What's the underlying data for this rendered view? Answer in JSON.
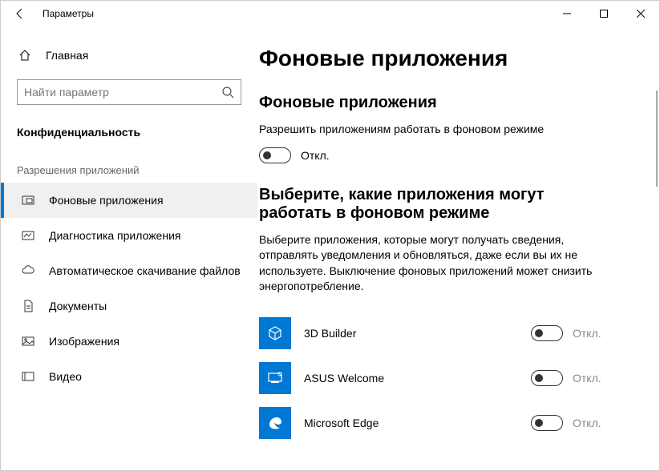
{
  "window": {
    "title": "Параметры"
  },
  "sidebar": {
    "home": "Главная",
    "search_placeholder": "Найти параметр",
    "category": "Конфиденциальность",
    "group_header": "Разрешения приложений",
    "items": [
      {
        "label": "Фоновые приложения",
        "active": true
      },
      {
        "label": "Диагностика приложения"
      },
      {
        "label": "Автоматическое скачивание файлов"
      },
      {
        "label": "Документы"
      },
      {
        "label": "Изображения"
      },
      {
        "label": "Видео"
      }
    ]
  },
  "main": {
    "heading": "Фоновые приложения",
    "section1_title": "Фоновые приложения",
    "section1_desc": "Разрешить приложениям работать в фоновом режиме",
    "master_toggle_state": "Откл.",
    "section2_title": "Выберите, какие приложения могут работать в фоновом режиме",
    "section2_desc": "Выберите приложения, которые могут получать сведения, отправлять уведомления и обновляться, даже если вы их не используете. Выключение фоновых приложений может снизить энергопотребление.",
    "apps": [
      {
        "name": "3D Builder",
        "state": "Откл."
      },
      {
        "name": "ASUS Welcome",
        "state": "Откл."
      },
      {
        "name": "Microsoft Edge",
        "state": "Откл."
      }
    ]
  }
}
